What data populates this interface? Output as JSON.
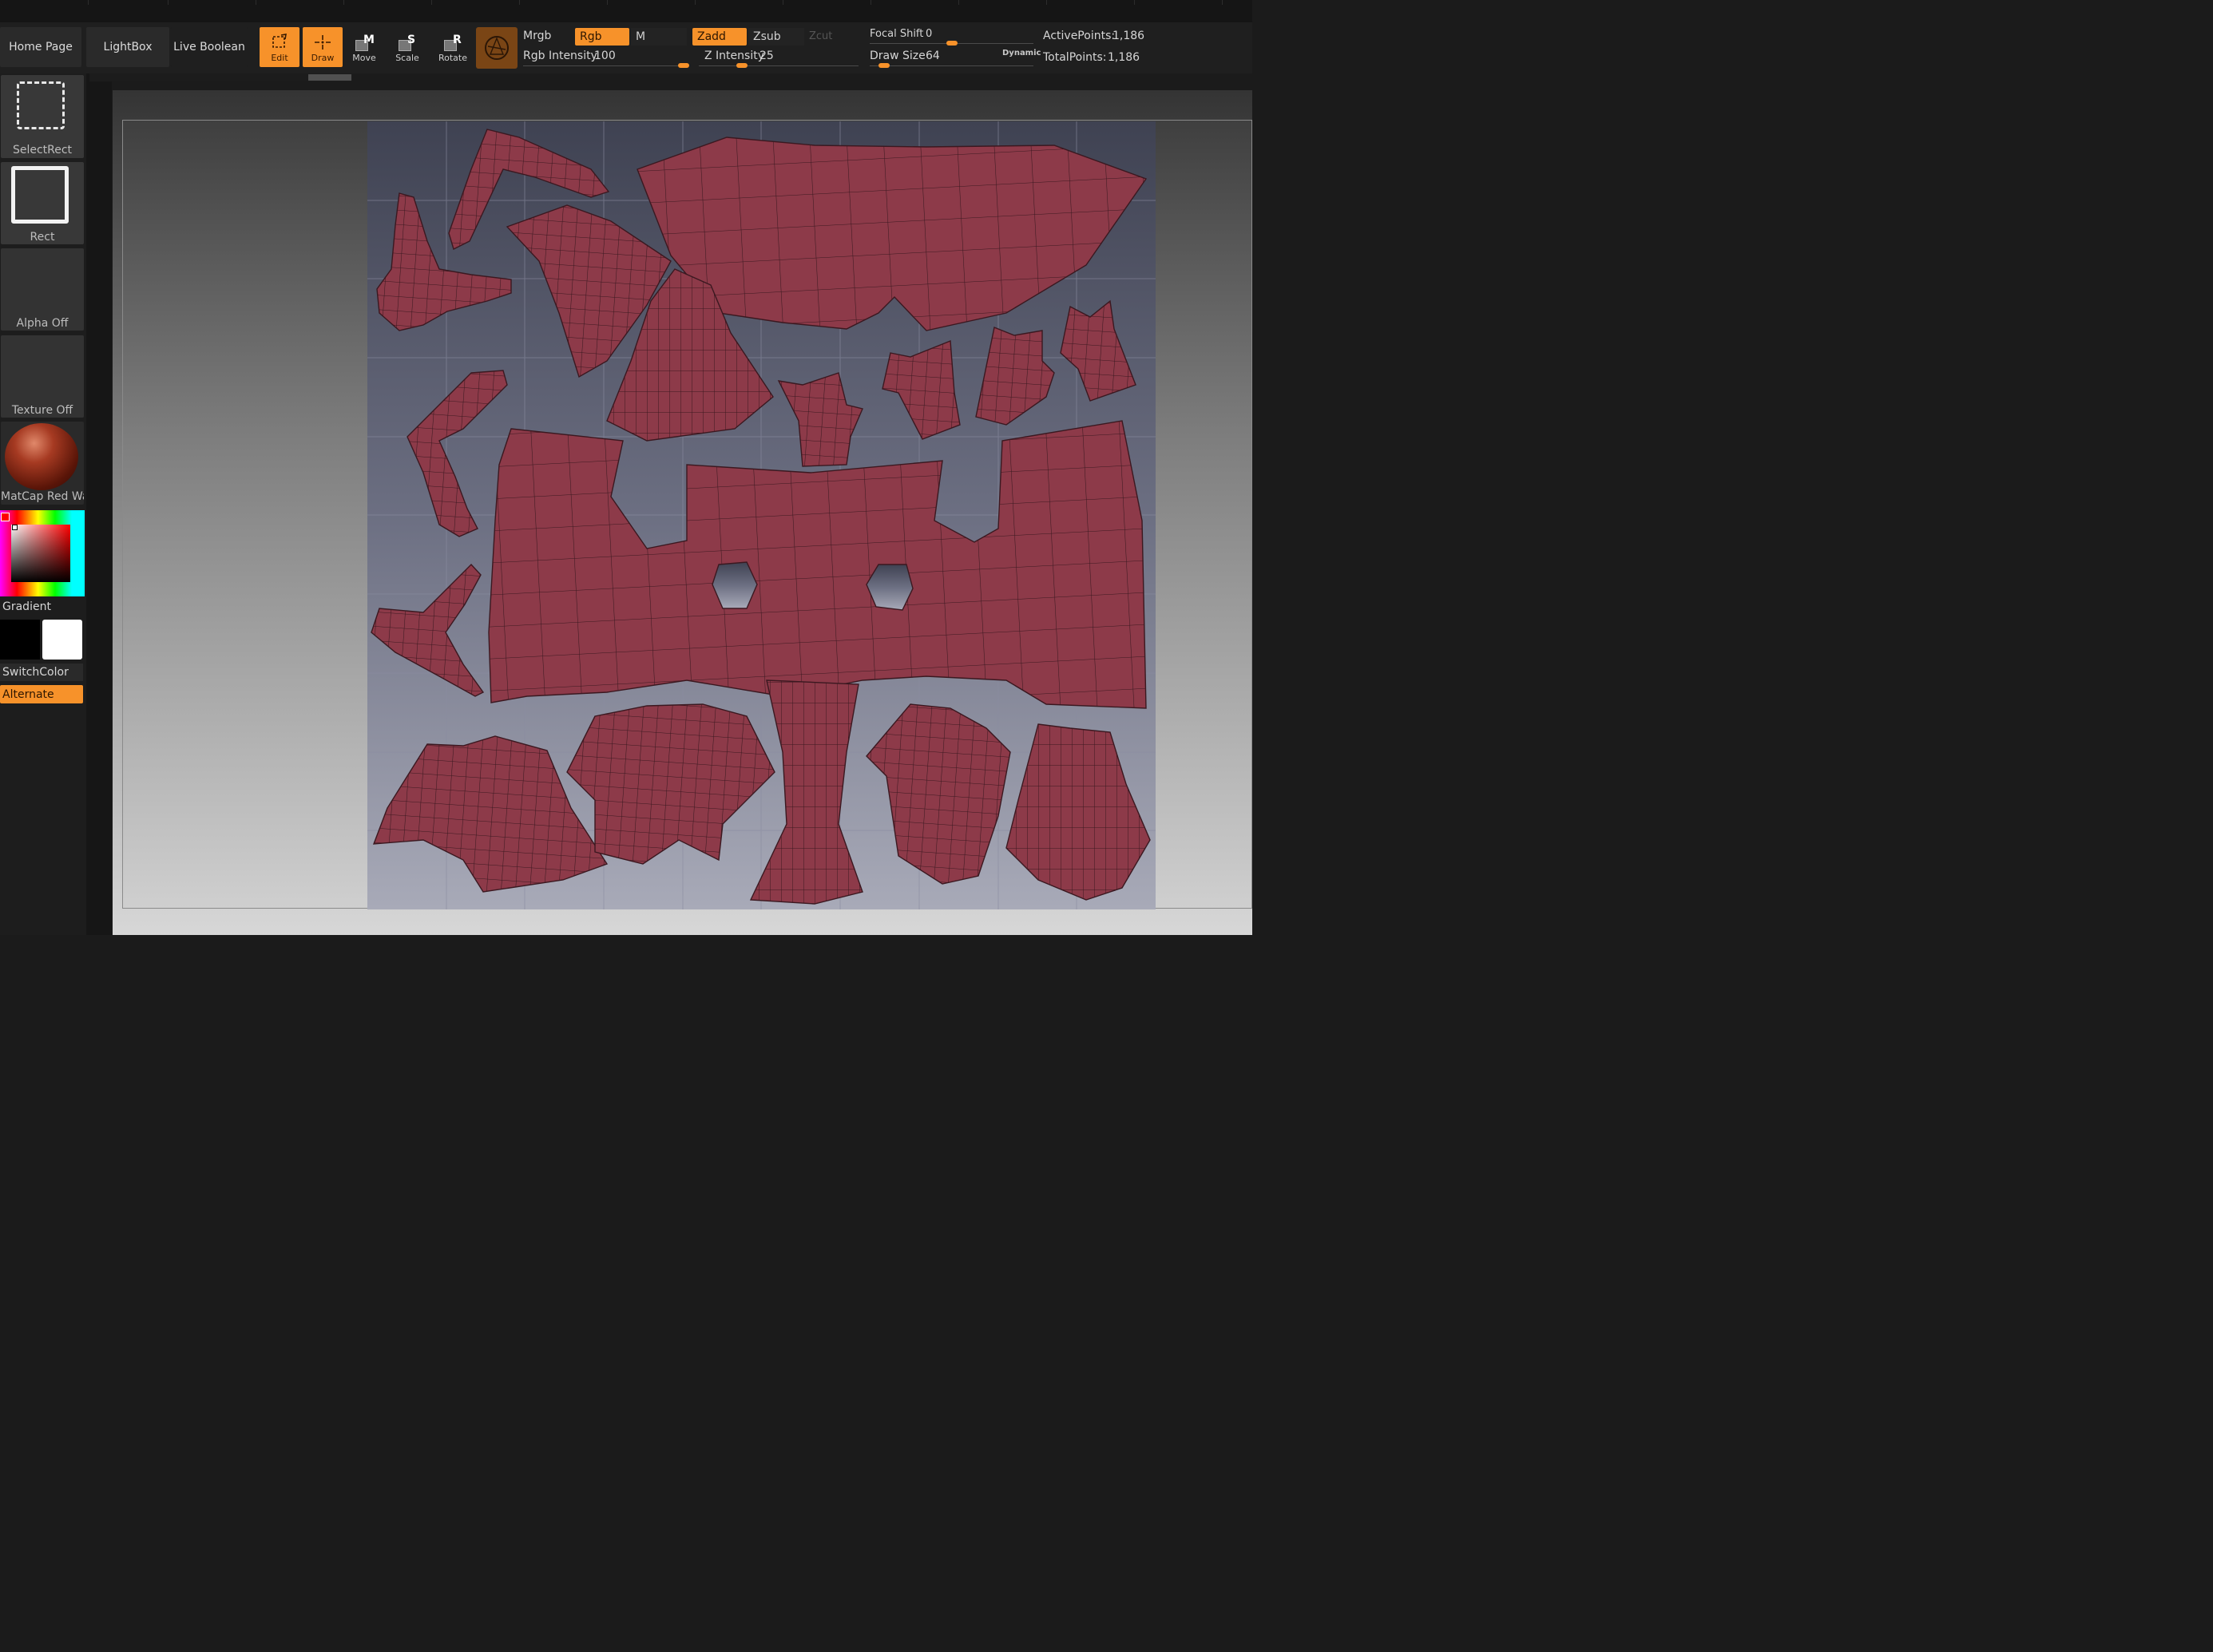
{
  "nav": {
    "home_page": "Home Page",
    "lightbox": "LightBox",
    "live_boolean": "Live Boolean"
  },
  "tools": {
    "edit": "Edit",
    "draw": "Draw",
    "move": "Move",
    "scale": "Scale",
    "rotate": "Rotate",
    "move_key": "M",
    "scale_key": "S",
    "rotate_key": "R"
  },
  "color_mode": {
    "mrgb": "Mrgb",
    "rgb": "Rgb",
    "m": "M",
    "rgb_intensity_label": "Rgb Intensity",
    "rgb_intensity_value": "100",
    "rgb_intensity_fraction": 1.0
  },
  "z_mode": {
    "zadd": "Zadd",
    "zsub": "Zsub",
    "zcut": "Zcut",
    "z_intensity_label": "Z Intensity",
    "z_intensity_value": "25",
    "z_intensity_fraction": 0.25
  },
  "brush": {
    "focal_shift_label": "Focal Shift",
    "focal_shift_value": "0",
    "focal_shift_fraction": 0.5,
    "draw_size_label": "Draw Size",
    "draw_size_value": "64",
    "draw_size_fraction": 0.06,
    "dynamic_label": "Dynamic"
  },
  "stats": {
    "active_points_label": "ActivePoints:",
    "active_points_value": "1,186",
    "total_points_label": "TotalPoints:",
    "total_points_value": "1,186"
  },
  "left_panel": {
    "select_rect": "SelectRect",
    "rect": "Rect",
    "alpha_off": "Alpha Off",
    "texture_off": "Texture Off",
    "matcap": "MatCap Red Wax",
    "gradient": "Gradient",
    "switch_color": "SwitchColor",
    "alternate": "Alternate"
  },
  "colors": {
    "accent": "#f7922a",
    "uv_fill": "#8d3a49",
    "uv_edge": "#3b1820",
    "panel": "#383838"
  }
}
